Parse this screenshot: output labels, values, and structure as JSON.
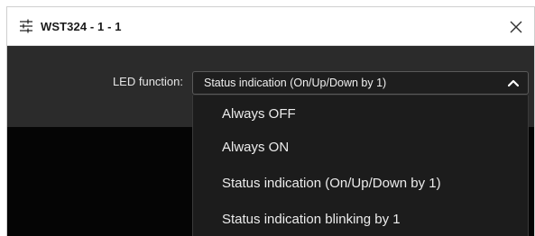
{
  "dialog": {
    "title": "WST324 - 1 - 1",
    "title_icon": "sliders-icon",
    "close_icon": "close-icon"
  },
  "settings": {
    "led_label": "LED function:",
    "selected_value": "Status indication (On/Up/Down by 1)",
    "chevron_icon": "chevron-up-icon"
  },
  "dropdown": {
    "options": [
      "Always OFF",
      "Always ON",
      "Status indication (On/Up/Down by 1)",
      "Status indication blinking by 1"
    ]
  },
  "colors": {
    "dialog_background": "#2b2b2b",
    "panel_background": "#050505",
    "dropdown_background": "#1c1c1c",
    "text_light": "#ececec",
    "titlebar_background": "#ffffff"
  }
}
